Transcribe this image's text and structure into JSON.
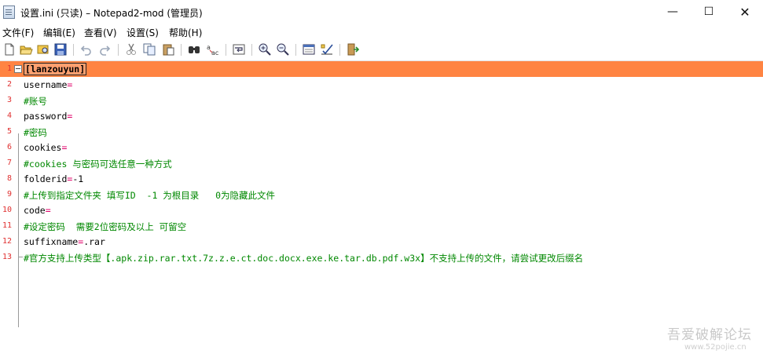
{
  "window": {
    "title": "设置.ini (只读) – Notepad2-mod (管理员)",
    "controls": {
      "minimize": "—",
      "maximize": "☐",
      "close": "✕"
    }
  },
  "menu": [
    "文件(F)",
    "编辑(E)",
    "查看(V)",
    "设置(S)",
    "帮助(H)"
  ],
  "toolbar": {
    "buttons": [
      "new-file-icon",
      "open-folder-icon",
      "browse-icon",
      "save-icon",
      "undo-icon",
      "redo-icon",
      "cut-icon",
      "copy-icon",
      "paste-icon",
      "find-icon",
      "replace-icon",
      "word-wrap-icon",
      "zoom-in-icon",
      "zoom-out-icon",
      "scheme-icon",
      "customize-icon",
      "exit-icon"
    ]
  },
  "editor": {
    "current_line": 1,
    "lines": [
      {
        "num": "1",
        "key": "[lanzouyun]",
        "value": "",
        "type": "section"
      },
      {
        "num": "2",
        "key": "username",
        "value": "",
        "type": "pair"
      },
      {
        "num": "3",
        "text": "#账号",
        "type": "comment"
      },
      {
        "num": "4",
        "key": "password",
        "value": "",
        "type": "pair"
      },
      {
        "num": "5",
        "text": "#密码",
        "type": "comment"
      },
      {
        "num": "6",
        "key": "cookies",
        "value": "",
        "type": "pair"
      },
      {
        "num": "7",
        "text": "#cookies 与密码可选任意一种方式",
        "type": "comment"
      },
      {
        "num": "8",
        "key": "folderid",
        "value": "-1",
        "type": "pair"
      },
      {
        "num": "9",
        "text": "#上传到指定文件夹 填写ID  -1 为根目录   0为隐藏此文件",
        "type": "comment"
      },
      {
        "num": "10",
        "key": "code",
        "value": "",
        "type": "pair"
      },
      {
        "num": "11",
        "text": "#设定密码  需要2位密码及以上 可留空",
        "type": "comment"
      },
      {
        "num": "12",
        "key": "suffixname",
        "value": ".rar",
        "type": "pair"
      },
      {
        "num": "13",
        "text": "#官方支持上传类型【.apk.zip.rar.txt.7z.z.e.ct.doc.docx.exe.ke.tar.db.pdf.w3x】不支持上传的文件，请尝试更改后缀名",
        "type": "comment"
      }
    ]
  },
  "watermark": {
    "line1": "吾爱破解论坛",
    "line2": "www.52pojie.cn"
  }
}
